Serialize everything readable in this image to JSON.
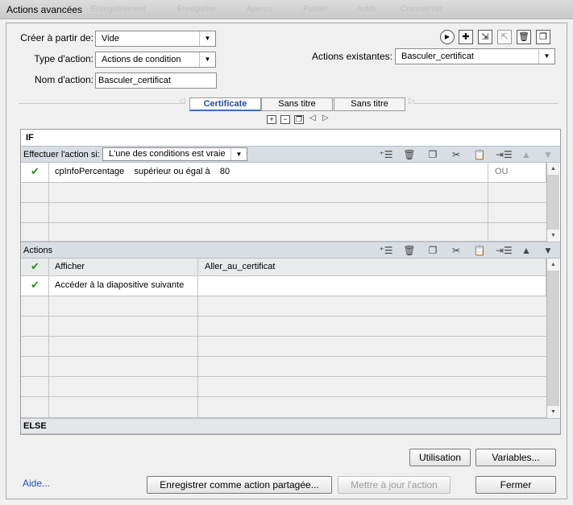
{
  "window": {
    "title": "Actions avancées",
    "ghost_tabs": [
      "Enregistrement",
      "Enregistrer",
      "Apercu",
      "Publier",
      "Actifs",
      "Commenter"
    ]
  },
  "form": {
    "create_from_label": "Créer à partir de:",
    "create_from_value": "Vide",
    "action_type_label": "Type d'action:",
    "action_type_value": "Actions de condition",
    "action_name_label": "Nom d'action:",
    "action_name_value": "Basculer_certificat",
    "existing_actions_label": "Actions existantes:",
    "existing_actions_value": "Basculer_certificat"
  },
  "toolbar": {
    "icons": [
      "preview-icon",
      "add-icon",
      "import-icon",
      "export-icon",
      "delete-icon",
      "duplicate-icon"
    ]
  },
  "tabs": [
    "Certificate",
    "Sans titre",
    "Sans titre"
  ],
  "if_section": {
    "header": "IF",
    "perform_label": "Effectuer l'action si:",
    "perform_value": "L'une des conditions est vraie",
    "conditions": [
      {
        "checked": true,
        "variable": "cpInfoPercentage",
        "operator": "supérieur ou égal à",
        "value": "80",
        "logic": "OU"
      }
    ]
  },
  "actions_section": {
    "header": "Actions",
    "rows": [
      {
        "checked": true,
        "action": "Afficher",
        "target": "Aller_au_certificat"
      },
      {
        "checked": true,
        "action": "Accéder à la diapositive suivante",
        "target": ""
      }
    ]
  },
  "else_section": {
    "header": "ELSE"
  },
  "buttons": {
    "usage": "Utilisation",
    "variables": "Variables...",
    "help": "Aide...",
    "save_shared": "Enregistrer comme action partagée...",
    "update_action": "Mettre à jour l'action",
    "close": "Fermer"
  },
  "colors": {
    "check": "#2e8f1a",
    "section_bar": "#d9dee4",
    "active_tab_text": "#1e4f9e",
    "link": "#1f55b5"
  }
}
